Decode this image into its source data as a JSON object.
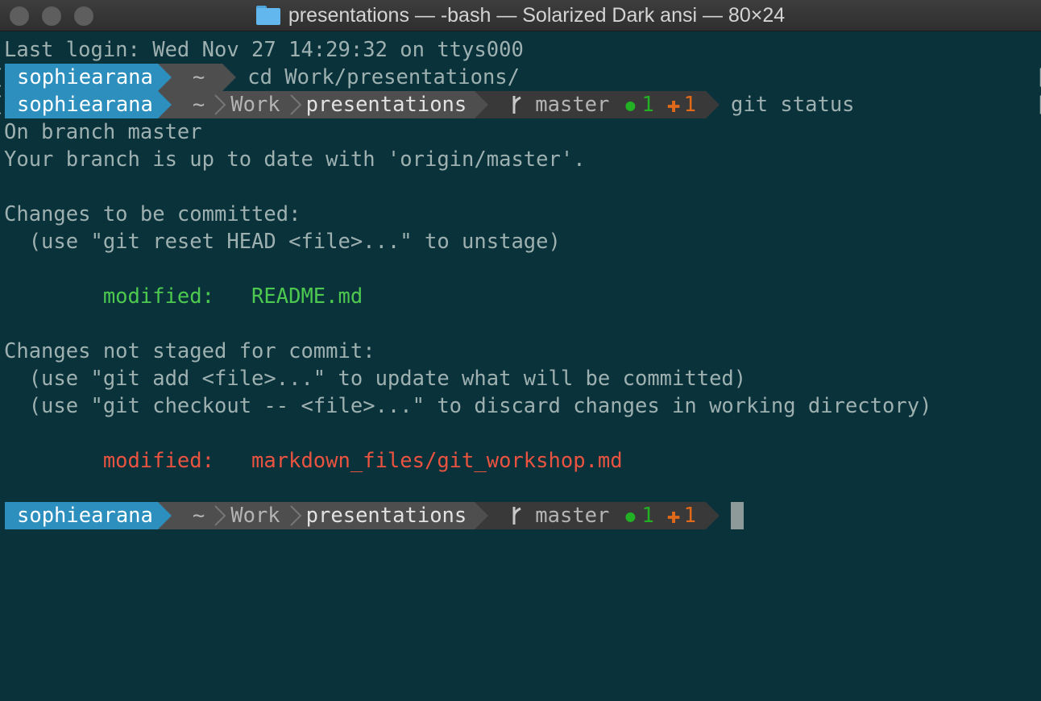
{
  "window": {
    "title": "presentations — -bash — Solarized Dark ansi — 80×24"
  },
  "terminal": {
    "last_login": "Last login: Wed Nov 27 14:29:32 on ttys000",
    "prompt1": {
      "user": "sophiearana",
      "dir": "~",
      "command": "cd Work/presentations/"
    },
    "prompt2": {
      "user": "sophiearana",
      "dir_home": "~",
      "dir_work": "Work",
      "dir_presentations": "presentations",
      "branch": "master",
      "staged_count": "1",
      "modified_count": "1",
      "command": "git status"
    },
    "output": {
      "on_branch": "On branch master",
      "up_to_date": "Your branch is up to date with 'origin/master'.",
      "staged_header": "Changes to be committed:",
      "staged_hint": "  (use \"git reset HEAD <file>...\" to unstage)",
      "staged_label": "        modified:   ",
      "staged_file": "README.md",
      "unstaged_header": "Changes not staged for commit:",
      "unstaged_hint1": "  (use \"git add <file>...\" to update what will be committed)",
      "unstaged_hint2": "  (use \"git checkout -- <file>...\" to discard changes in working directory)",
      "unstaged_label": "        modified:   ",
      "unstaged_file": "markdown_files/git_workshop.md"
    },
    "prompt3": {
      "user": "sophiearana",
      "dir_home": "~",
      "dir_work": "Work",
      "dir_presentations": "presentations",
      "branch": "master",
      "staged_count": "1",
      "modified_count": "1"
    }
  },
  "colors": {
    "background": "#0a323b",
    "user_segment": "#2c8fbd",
    "dir_segment": "#4e4e4e",
    "git_segment": "#393939",
    "staged_green": "#4dc94f",
    "unstaged_red": "#ea5340",
    "count_green": "#22b024",
    "count_orange": "#e06a1a"
  },
  "icons": {
    "folder": "folder-icon",
    "branch": "git-branch-icon",
    "staged": "green-dot-icon",
    "modified": "orange-plus-icon"
  }
}
